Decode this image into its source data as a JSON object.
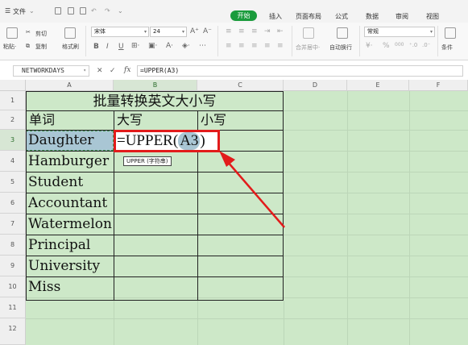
{
  "menubar": {
    "file_label": "文件",
    "tabs": [
      "开始",
      "插入",
      "页面布局",
      "公式",
      "数据",
      "审阅",
      "视图"
    ]
  },
  "ribbon": {
    "paste_label": "粘贴·",
    "cut_label": "剪切",
    "copy_label": "复制",
    "format_painter_label": "格式刷",
    "font_name": "宋体",
    "font_size": "24",
    "bold": "B",
    "italic": "I",
    "underline": "U",
    "merge_label": "合并居中·",
    "wrap_label": "自动换行",
    "number_format": "常规",
    "currency_symbol": "¥",
    "percent_symbol": "%",
    "thousands_symbol": "000",
    "conditional_label": "条件"
  },
  "formula_bar": {
    "name_box": "NETWORKDAYS",
    "fx": "fx",
    "formula": "=UPPER(A3)"
  },
  "columns": [
    "A",
    "B",
    "C",
    "D",
    "E",
    "F"
  ],
  "rows": [
    "1",
    "2",
    "3",
    "4",
    "5",
    "6",
    "7",
    "8",
    "9",
    "10",
    "11",
    "12"
  ],
  "sheet": {
    "title": "批量转换英文大小写",
    "header_word": "单词",
    "header_upper": "大写",
    "header_lower": "小写",
    "words": [
      "Daughter",
      "Hamburger",
      "Student",
      "Accountant",
      "Watermelon",
      "Principal",
      "University",
      "Miss"
    ],
    "b3_prefix": "=UPPER(",
    "b3_ref": "A3",
    "b3_suffix": ")",
    "tooltip": "UPPER (字符串)"
  },
  "colors": {
    "active_tab": "#1a9b3c",
    "sheet_bg": "#cde8c8",
    "annotation": "#e21b1b",
    "selection": "#a9c6d4"
  }
}
